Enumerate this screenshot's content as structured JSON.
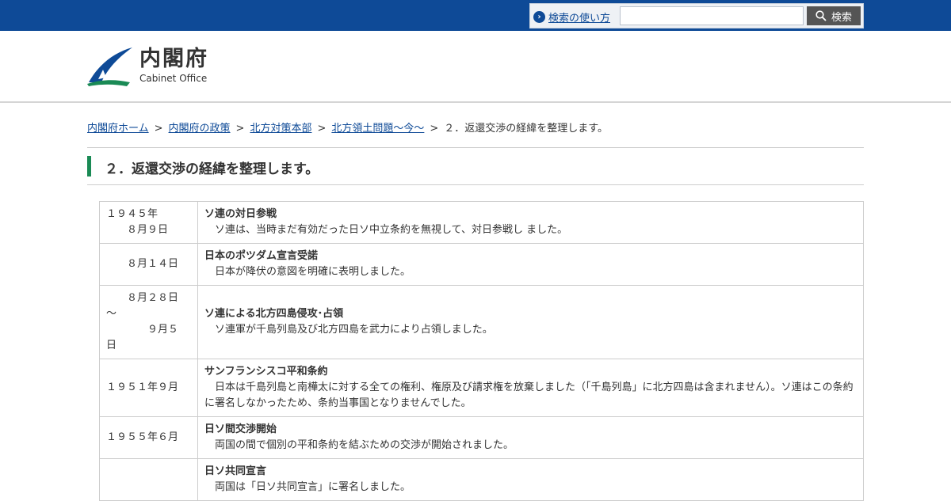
{
  "search": {
    "help_label": "検索の使い方",
    "input_value": "",
    "button_label": "検索"
  },
  "logo": {
    "name_jp": "内閣府",
    "name_en": "Cabinet Office"
  },
  "breadcrumb": {
    "items": [
      "内閣府ホーム",
      "内閣府の政策",
      "北方対策本部",
      "北方領土問題～今～"
    ],
    "current": "２．返還交渉の経緯を整理します。",
    "separator": ">"
  },
  "page_title": "２．返還交渉の経緯を整理します。",
  "history": {
    "rows": [
      {
        "date": "１９４５年\n　　８月９日",
        "title": "ソ連の対日参戦",
        "desc": "　ソ連は、当時まだ有効だった日ソ中立条約を無視して、対日参戦し ました。"
      },
      {
        "date": "　　８月１４日",
        "title": "日本のポツダム宣言受諾",
        "desc": "　日本が降伏の意図を明確に表明しました。"
      },
      {
        "date": "　　８月２８日\n～\n　　　　９月５\n日",
        "title": "ソ連による北方四島侵攻･占領",
        "desc": "　ソ連軍が千島列島及び北方四島を武力により占領しました。"
      },
      {
        "date": "１９５１年９月",
        "title": "サンフランシスコ平和条約",
        "desc": "　日本は千島列島と南樺太に対する全ての権利、権原及び請求権を放棄しました（「千島列島」に北方四島は含まれません）。ソ連はこの条約に署名しなかったため、条約当事国となりませんでした。"
      },
      {
        "date": "１９５５年６月",
        "title": "日ソ間交渉開始",
        "desc": "　両国の間で個別の平和条約を結ぶための交渉が開始されました。"
      },
      {
        "date": "",
        "title": "日ソ共同宣言",
        "desc": "　両国は「日ソ共同宣言」に署名しました。"
      }
    ]
  },
  "colors": {
    "topbar": "#0e4a97",
    "link": "#0e4a97",
    "title_accent": "#1a8a55"
  }
}
